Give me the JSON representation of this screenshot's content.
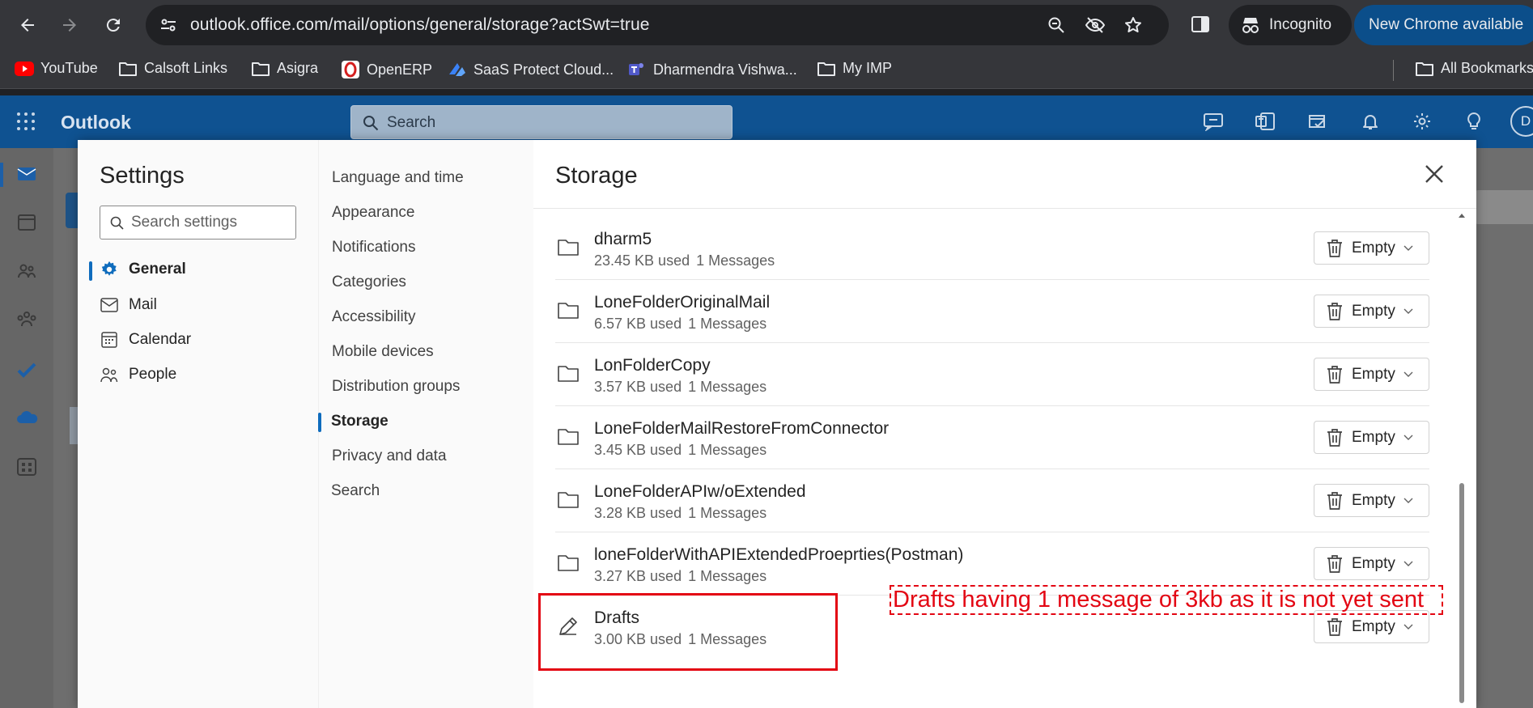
{
  "browser": {
    "url": "outlook.office.com/mail/options/general/storage?actSwt=true",
    "incognito_label": "Incognito",
    "update_label": "New Chrome available",
    "bookmarks": [
      {
        "label": "YouTube",
        "icon": "youtube-icon"
      },
      {
        "label": "Calsoft Links",
        "icon": "folder-icon"
      },
      {
        "label": "Asigra",
        "icon": "folder-icon"
      },
      {
        "label": "OpenERP",
        "icon": "openerp-icon"
      },
      {
        "label": "SaaS Protect Cloud...",
        "icon": "saas-protect-icon"
      },
      {
        "label": "Dharmendra Vishwa...",
        "icon": "teams-icon"
      },
      {
        "label": "My IMP",
        "icon": "folder-icon"
      }
    ],
    "all_bookmarks_label": "All Bookmarks"
  },
  "outlook": {
    "brand": "Outlook",
    "search_placeholder": "Search",
    "avatar_initial": "D",
    "brand_color": "#0f5291"
  },
  "settings": {
    "title": "Settings",
    "search_placeholder": "Search settings",
    "categories": [
      {
        "label": "General",
        "icon": "gear-icon",
        "active": true
      },
      {
        "label": "Mail",
        "icon": "mail-icon"
      },
      {
        "label": "Calendar",
        "icon": "calendar-icon"
      },
      {
        "label": "People",
        "icon": "people-icon"
      }
    ],
    "general_items": [
      {
        "label": "Language and time"
      },
      {
        "label": "Appearance"
      },
      {
        "label": "Notifications"
      },
      {
        "label": "Categories"
      },
      {
        "label": "Accessibility"
      },
      {
        "label": "Mobile devices"
      },
      {
        "label": "Distribution groups"
      },
      {
        "label": "Storage",
        "active": true
      },
      {
        "label": "Privacy and data"
      },
      {
        "label": "Search"
      }
    ]
  },
  "storage": {
    "title": "Storage",
    "empty_label": "Empty",
    "folders": [
      {
        "name": "dharm5",
        "size": "23.45 KB used",
        "count": "1 Messages",
        "icon": "folder-icon"
      },
      {
        "name": "LoneFolderOriginalMail",
        "size": "6.57 KB used",
        "count": "1 Messages",
        "icon": "folder-icon"
      },
      {
        "name": "LonFolderCopy",
        "size": "3.57 KB used",
        "count": "1 Messages",
        "icon": "folder-icon"
      },
      {
        "name": "LoneFolderMailRestoreFromConnector",
        "size": "3.45 KB used",
        "count": "1 Messages",
        "icon": "folder-icon"
      },
      {
        "name": "LoneFolderAPIw/oExtended",
        "size": "3.28 KB used",
        "count": "1 Messages",
        "icon": "folder-icon"
      },
      {
        "name": "loneFolderWithAPIExtendedProeprties(Postman)",
        "size": "3.27 KB used",
        "count": "1 Messages",
        "icon": "folder-icon"
      },
      {
        "name": "Drafts",
        "size": "3.00 KB used",
        "count": "1 Messages",
        "icon": "pencil-icon"
      }
    ]
  },
  "annotation": {
    "note": "Drafts having 1 message of 3kb as it is not yet sent",
    "color": "#e30613"
  }
}
